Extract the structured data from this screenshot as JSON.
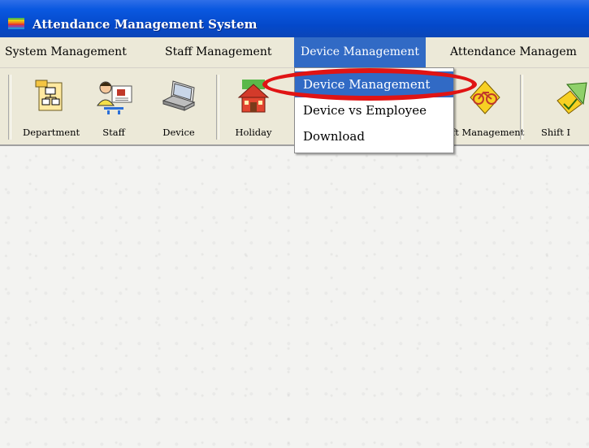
{
  "window": {
    "title": "Attendance Management System",
    "icon": "apple-app-icon"
  },
  "menubar": {
    "items": [
      {
        "label": "System Management"
      },
      {
        "label": "Staff Management"
      },
      {
        "label": "Device Management",
        "active": true
      },
      {
        "label": "Attendance Managem"
      }
    ]
  },
  "toolbar": {
    "buttons": [
      {
        "label": "Department",
        "icon": "department-icon"
      },
      {
        "label": "Staff",
        "icon": "staff-icon"
      },
      {
        "label": "Device",
        "icon": "device-icon"
      },
      {
        "label": "Holiday",
        "icon": "holiday-icon"
      },
      {
        "label": "ft Management",
        "icon": "shift-management-icon"
      },
      {
        "label": "Shift I",
        "icon": "shift-icon"
      }
    ]
  },
  "dropdown": {
    "items": [
      {
        "label": "Device Management",
        "active": true
      },
      {
        "label": "Device vs Employee"
      },
      {
        "label": "Download"
      }
    ]
  },
  "annotation": {
    "color": "#e01414"
  },
  "colors": {
    "titlebar": "#0a58e0",
    "menu_highlight": "#316ac5",
    "chrome": "#ece9d8"
  }
}
